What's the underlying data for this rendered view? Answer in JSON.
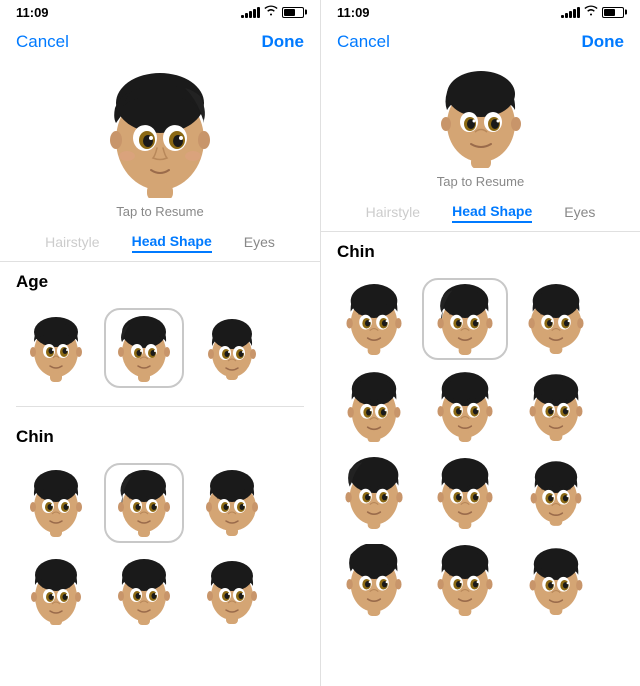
{
  "left_panel": {
    "status": {
      "time": "11:09",
      "signal_bars": [
        3,
        5,
        7,
        9,
        11
      ],
      "battery_level": "60%"
    },
    "nav": {
      "cancel_label": "Cancel",
      "done_label": "Done"
    },
    "tap_to_resume": "Tap to Resume",
    "tabs": [
      {
        "label": "Hairstyle",
        "state": "faded"
      },
      {
        "label": "Head Shape",
        "state": "active"
      },
      {
        "label": "Eyes",
        "state": "normal"
      }
    ],
    "sections": [
      {
        "title": "Age",
        "items": [
          {
            "id": "age-1",
            "selected": false
          },
          {
            "id": "age-2",
            "selected": true
          },
          {
            "id": "age-3",
            "selected": false
          }
        ]
      },
      {
        "title": "Chin",
        "items": [
          {
            "id": "chin-1",
            "selected": false
          },
          {
            "id": "chin-2",
            "selected": true
          },
          {
            "id": "chin-3",
            "selected": false
          },
          {
            "id": "chin-4",
            "selected": false
          },
          {
            "id": "chin-5",
            "selected": false
          },
          {
            "id": "chin-6",
            "selected": false
          }
        ]
      }
    ]
  },
  "right_panel": {
    "status": {
      "time": "11:09",
      "signal_bars": [
        3,
        5,
        7,
        9,
        11
      ],
      "battery_level": "60%"
    },
    "nav": {
      "cancel_label": "Cancel",
      "done_label": "Done"
    },
    "tap_to_resume": "Tap to Resume",
    "tabs": [
      {
        "label": "Hairstyle",
        "state": "faded"
      },
      {
        "label": "Head Shape",
        "state": "active"
      },
      {
        "label": "Eyes",
        "state": "normal"
      }
    ],
    "sections": [
      {
        "title": "Chin",
        "items": [
          {
            "id": "r-chin-1",
            "selected": false
          },
          {
            "id": "r-chin-2",
            "selected": true
          },
          {
            "id": "r-chin-3",
            "selected": false
          },
          {
            "id": "r-chin-4",
            "selected": false
          },
          {
            "id": "r-chin-5",
            "selected": false
          },
          {
            "id": "r-chin-6",
            "selected": false
          },
          {
            "id": "r-chin-7",
            "selected": false
          },
          {
            "id": "r-chin-8",
            "selected": false
          },
          {
            "id": "r-chin-9",
            "selected": false
          },
          {
            "id": "r-chin-10",
            "selected": false
          },
          {
            "id": "r-chin-11",
            "selected": false
          },
          {
            "id": "r-chin-12",
            "selected": false
          }
        ]
      }
    ]
  }
}
